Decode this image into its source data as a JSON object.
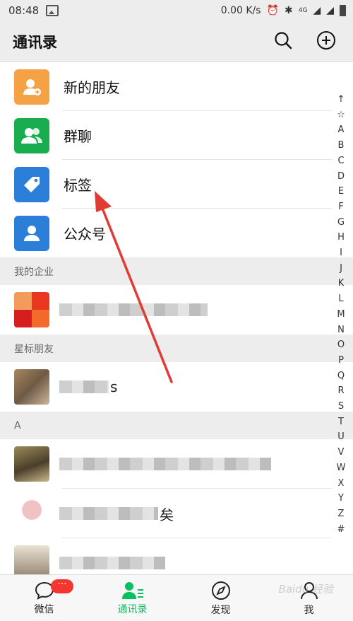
{
  "status_bar": {
    "time": "08:48",
    "speed": "0.00 K/s",
    "network": "4G"
  },
  "header": {
    "title": "通讯录"
  },
  "features": [
    {
      "label": "新的朋友",
      "color": "#f5a246",
      "icon": "add-friend-icon"
    },
    {
      "label": "群聊",
      "color": "#1aad4f",
      "icon": "group-chat-icon"
    },
    {
      "label": "标签",
      "color": "#2b7fd9",
      "icon": "tag-icon"
    },
    {
      "label": "公众号",
      "color": "#2b7fd9",
      "icon": "official-account-icon"
    }
  ],
  "sections": {
    "enterprise": "我的企业",
    "starred": "星标朋友",
    "a": "A"
  },
  "contacts": {
    "enterprise_tail": "",
    "starred_tail": "s",
    "a1_tail": "",
    "a2_tail": "矣",
    "a3_tail": ""
  },
  "index_letters": [
    "↑",
    "☆",
    "A",
    "B",
    "C",
    "D",
    "E",
    "F",
    "G",
    "H",
    "I",
    "J",
    "K",
    "L",
    "M",
    "N",
    "O",
    "P",
    "Q",
    "R",
    "S",
    "T",
    "U",
    "V",
    "W",
    "X",
    "Y",
    "Z",
    "#"
  ],
  "tabs": [
    {
      "label": "微信",
      "badge": "···",
      "icon": "chat-icon"
    },
    {
      "label": "通讯录",
      "icon": "contacts-icon",
      "active": true
    },
    {
      "label": "发现",
      "icon": "compass-icon"
    },
    {
      "label": "我",
      "icon": "me-icon"
    }
  ],
  "watermark": "Baidu 经验",
  "colors": {
    "accent_green": "#07c160",
    "annotation_red": "#e23a35"
  }
}
